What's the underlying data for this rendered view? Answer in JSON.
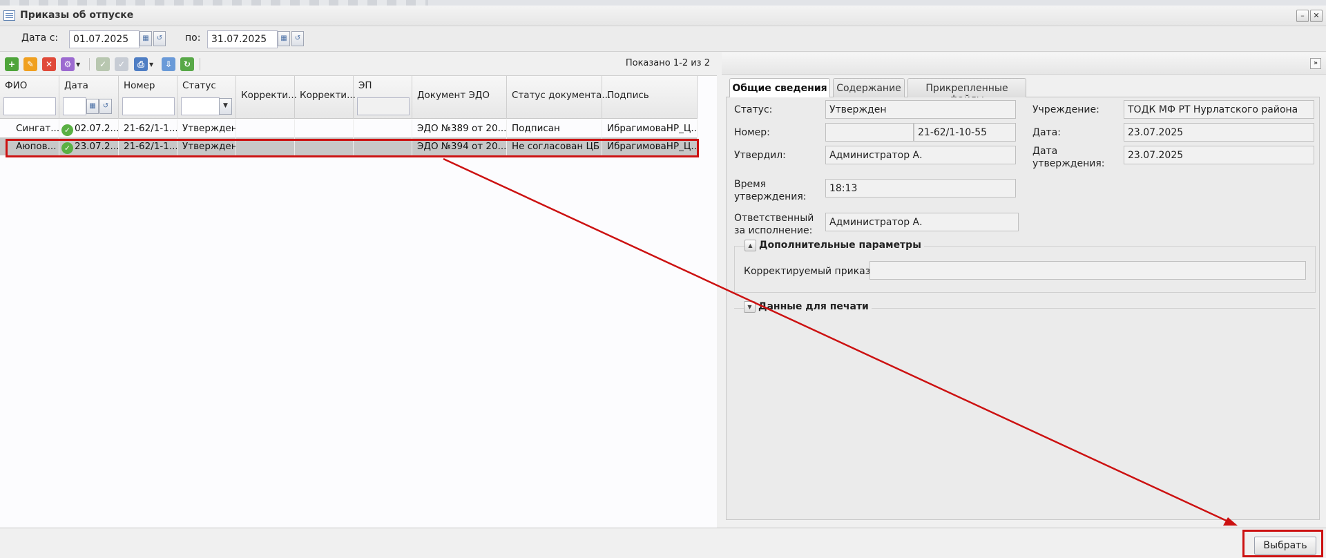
{
  "window": {
    "title": "Приказы об отпуске",
    "minimize_glyph": "–",
    "close_glyph": "✕"
  },
  "filter": {
    "date_from_label": "Дата с:",
    "date_from_value": "01.07.2025",
    "date_to_label": "по:",
    "date_to_value": "31.07.2025"
  },
  "toolbar": {
    "shown_text": "Показано 1-2 из 2"
  },
  "grid": {
    "columns": [
      "ФИО",
      "Дата",
      "Номер",
      "Статус",
      "Корректи...",
      "Корректи...",
      "ЭП",
      "Документ ЭДО",
      "Статус документа...",
      "Подпись"
    ],
    "rows": [
      {
        "fio": "Сингат...",
        "date": "02.07.2...",
        "number": "21-62/1-1...",
        "status": "Утвержден",
        "corr1": "",
        "corr2": "",
        "ep": "",
        "edo": "ЭДО №389 от 20...",
        "doc_status": "Подписан",
        "signature": "ИбрагимоваНР_Ц..."
      },
      {
        "fio": "Аюпов...",
        "date": "23.07.2...",
        "number": "21-62/1-1...",
        "status": "Утвержден",
        "corr1": "",
        "corr2": "",
        "ep": "",
        "edo": "ЭДО №394 от 20...",
        "doc_status": "Не согласован ЦБ",
        "signature": "ИбрагимоваНР_Ц..."
      }
    ]
  },
  "details": {
    "tabs": [
      "Общие сведения",
      "Содержание",
      "Прикрепленные файлы"
    ],
    "status_label": "Статус:",
    "status_value": "Утвержден",
    "number_label": "Номер:",
    "number_prefix": "",
    "number_value": "21-62/1-10-55",
    "approved_by_label": "Утвердил:",
    "approved_by_value": "Администратор А.",
    "approval_time_label_1": "Время",
    "approval_time_label_2": "утверждения:",
    "approval_time_value": "18:13",
    "responsible_label_1": "Ответственный",
    "responsible_label_2": "за исполнение:",
    "responsible_value": "Администратор А.",
    "institution_label": "Учреждение:",
    "institution_value": "ТОДК МФ РТ Нурлатского района",
    "date_label": "Дата:",
    "date_value": "23.07.2025",
    "approval_date_label_1": "Дата",
    "approval_date_label_2": "утверждения:",
    "approval_date_value": "23.07.2025",
    "extra_params_title": "Дополнительные параметры",
    "corrected_order_label": "Корректируемый приказ:",
    "corrected_order_value": "",
    "print_data_title": "Данные для печати"
  },
  "footer": {
    "select_button": "Выбрать"
  },
  "colors": {
    "annotation": "#cc1111",
    "selected_row": "#c7c7c7",
    "status_ok": "#5ab044"
  }
}
